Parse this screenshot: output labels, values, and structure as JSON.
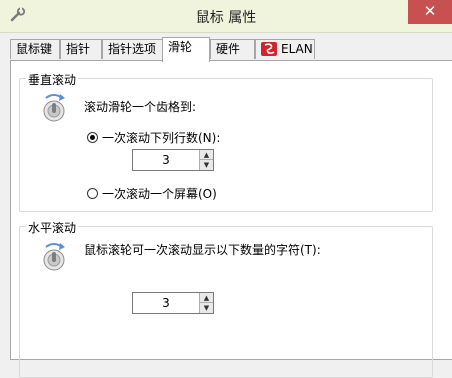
{
  "window": {
    "title": "鼠标 属性",
    "close_symbol": "✕",
    "title_icon": "settings-tool-icon"
  },
  "tabs": [
    {
      "label": "鼠标键"
    },
    {
      "label": "指针"
    },
    {
      "label": "指针选项"
    },
    {
      "label": "滑轮",
      "active": true
    },
    {
      "label": "硬件"
    },
    {
      "label": "ELAN",
      "icon": "elan-logo-icon"
    }
  ],
  "vertical": {
    "group_label": "垂直滚动",
    "description": "滚动滑轮一个齿格到:",
    "option_lines_label": "一次滚动下列行数(N):",
    "lines_value": "3",
    "option_screen_label": "一次滚动一个屏幕(O)",
    "selected_option": "lines"
  },
  "horizontal": {
    "group_label": "水平滚动",
    "description": "鼠标滚轮可一次滚动显示以下数量的字符(T):",
    "chars_value": "3"
  },
  "colors": {
    "titlebar": "#f1f4dc",
    "close_button": "#c75050",
    "elan_red": "#d1242d"
  }
}
